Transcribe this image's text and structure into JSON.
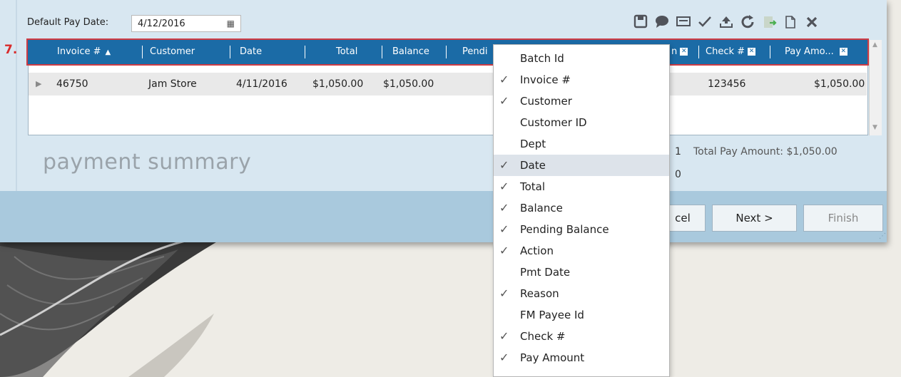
{
  "form": {
    "pay_date_label": "Default Pay Date:",
    "pay_date_value": "4/12/2016",
    "step_label": "7."
  },
  "toolbar": {
    "icons": [
      "save-icon",
      "comment-icon",
      "card-icon",
      "check-icon",
      "upload-icon",
      "refresh-icon",
      "export-icon",
      "copy-icon",
      "close-icon"
    ]
  },
  "grid": {
    "headers": {
      "invoice": "Invoice #",
      "customer": "Customer",
      "date": "Date",
      "total": "Total",
      "balance": "Balance",
      "pending": "Pendi",
      "reason_partial": "n",
      "check": "Check #",
      "pay_amount": "Pay Amo..."
    },
    "rows": [
      {
        "invoice": "46750",
        "customer": "Jam Store",
        "date": "4/11/2016",
        "total": "$1,050.00",
        "balance": "$1,050.00",
        "check": "123456",
        "pay_amount": "$1,050.00"
      }
    ]
  },
  "summary": {
    "title": "payment summary",
    "count_1": "1",
    "count_2": "0",
    "total_pay_amount_label": "Total Pay Amount: $1,050.00"
  },
  "buttons": {
    "cancel": "cel",
    "next": "Next >",
    "finish": "Finish"
  },
  "column_menu": {
    "items": [
      {
        "label": "Batch Id",
        "checked": false
      },
      {
        "label": "Invoice #",
        "checked": true
      },
      {
        "label": "Customer",
        "checked": true
      },
      {
        "label": "Customer ID",
        "checked": false
      },
      {
        "label": "Dept",
        "checked": false
      },
      {
        "label": "Date",
        "checked": true
      },
      {
        "label": "Total",
        "checked": true
      },
      {
        "label": "Balance",
        "checked": true
      },
      {
        "label": "Pending Balance",
        "checked": true
      },
      {
        "label": "Action",
        "checked": true
      },
      {
        "label": "Pmt Date",
        "checked": false
      },
      {
        "label": "Reason",
        "checked": true
      },
      {
        "label": "FM Payee Id",
        "checked": false
      },
      {
        "label": "Check #",
        "checked": true
      },
      {
        "label": "Pay Amount",
        "checked": true
      }
    ],
    "highlighted": "Date"
  },
  "colors": {
    "header_bg": "#1b6ba6",
    "highlight_border": "#cf3b43",
    "footer_bg": "#a9c9dd"
  }
}
